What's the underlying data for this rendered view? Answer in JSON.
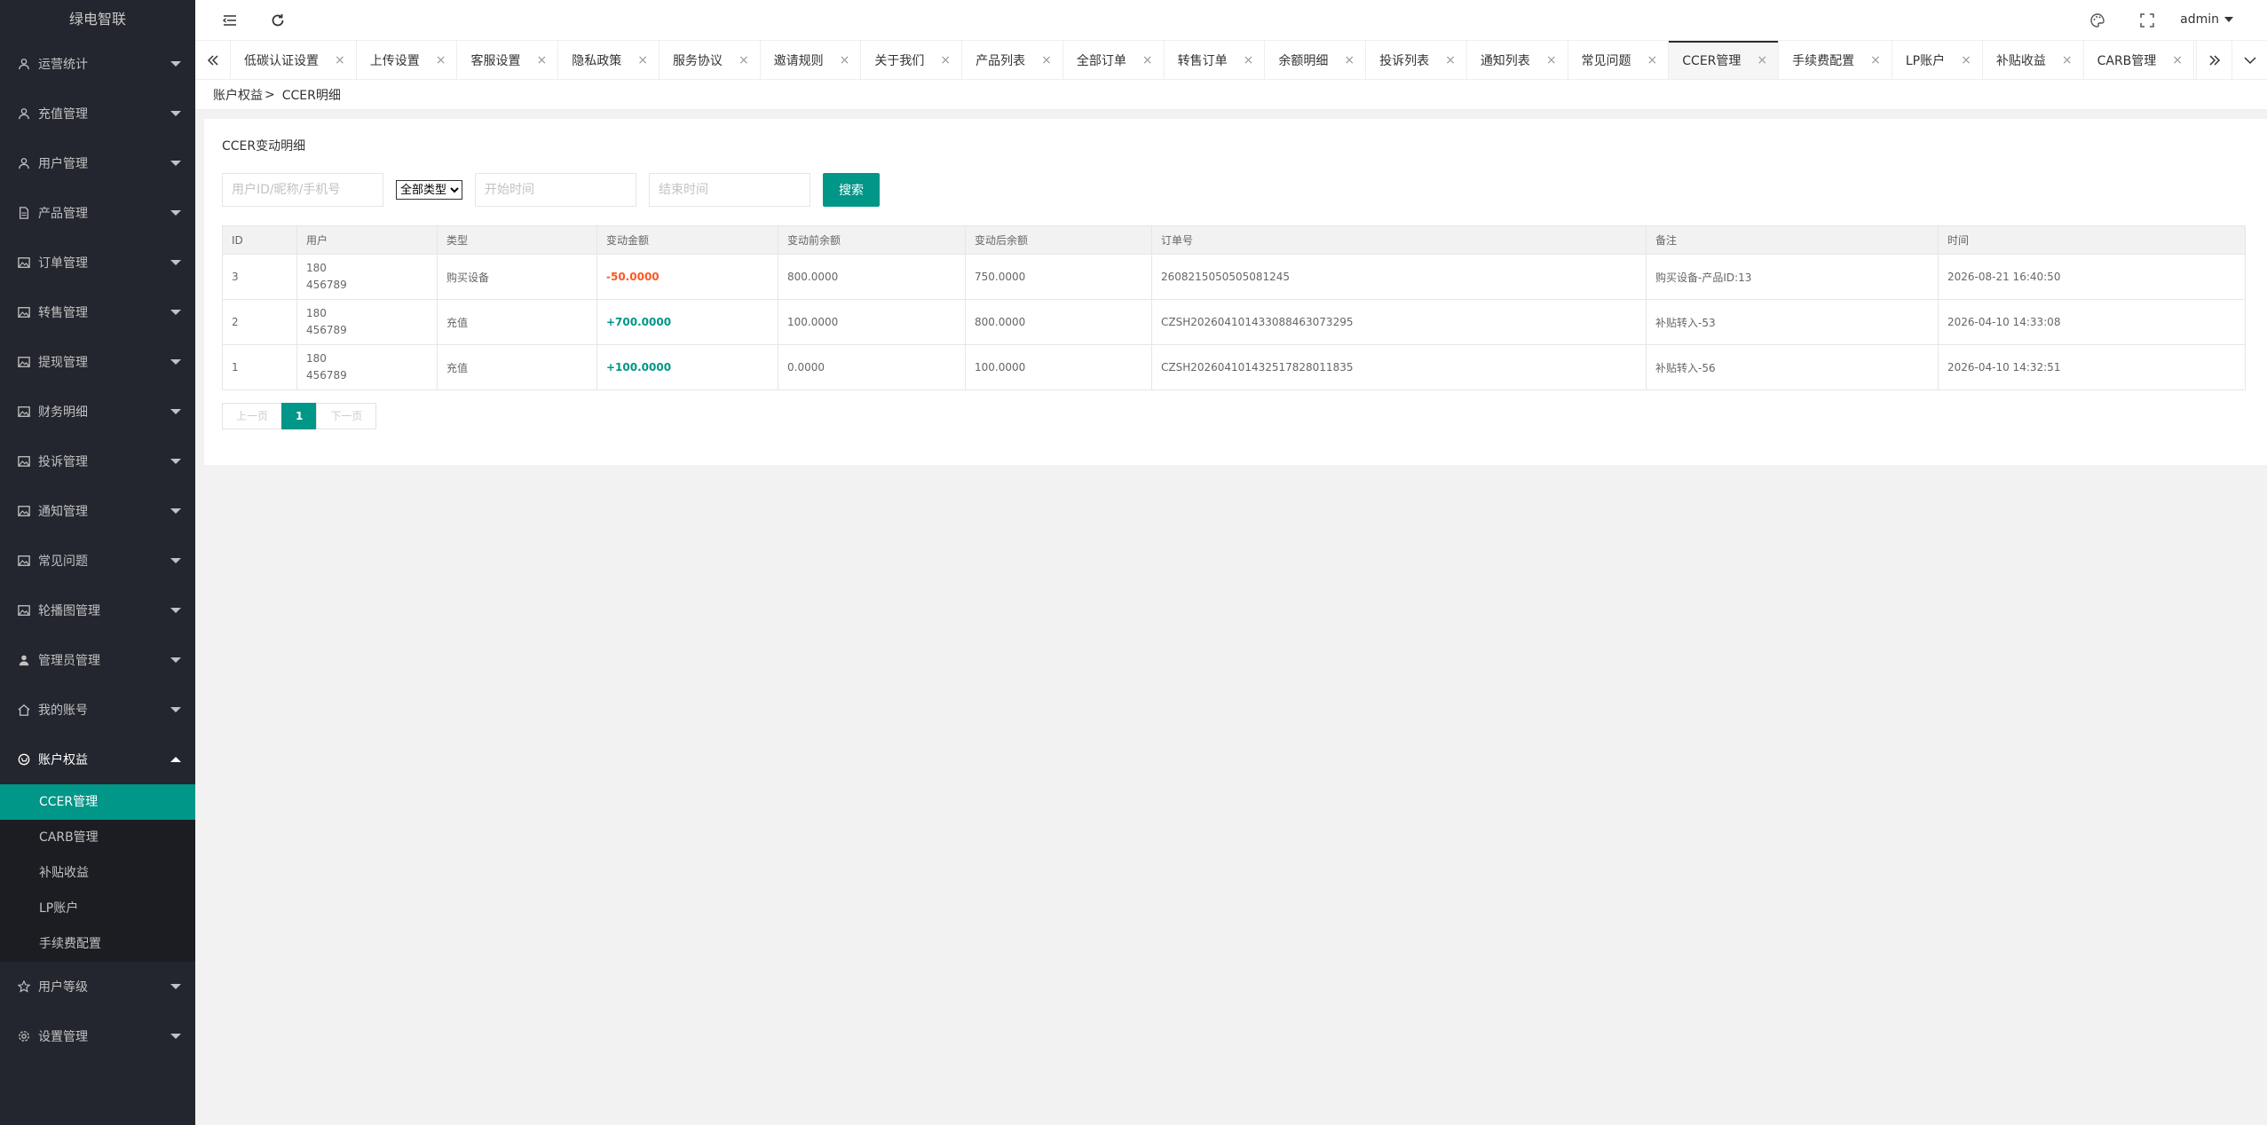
{
  "app": {
    "title": "绿电智联"
  },
  "sidebar": {
    "items": [
      {
        "label": "运营统计",
        "icon": "user-icon"
      },
      {
        "label": "充值管理",
        "icon": "user-icon"
      },
      {
        "label": "用户管理",
        "icon": "user-icon"
      },
      {
        "label": "产品管理",
        "icon": "file-icon"
      },
      {
        "label": "订单管理",
        "icon": "image-icon"
      },
      {
        "label": "转售管理",
        "icon": "image-icon"
      },
      {
        "label": "提现管理",
        "icon": "image-icon"
      },
      {
        "label": "财务明细",
        "icon": "image-icon"
      },
      {
        "label": "投诉管理",
        "icon": "image-icon"
      },
      {
        "label": "通知管理",
        "icon": "image-icon"
      },
      {
        "label": "常见问题",
        "icon": "image-icon"
      },
      {
        "label": "轮播图管理",
        "icon": "image-icon"
      },
      {
        "label": "管理员管理",
        "icon": "person-icon"
      },
      {
        "label": "我的账号",
        "icon": "home-icon"
      },
      {
        "label": "账户权益",
        "icon": "cart-icon"
      }
    ],
    "sub_items": [
      {
        "label": "CCER管理"
      },
      {
        "label": "CARB管理"
      },
      {
        "label": "补贴收益"
      },
      {
        "label": "LP账户"
      },
      {
        "label": "手续费配置"
      }
    ],
    "bottom_items": [
      {
        "label": "用户等级",
        "icon": "star-icon"
      },
      {
        "label": "设置管理",
        "icon": "gear-icon"
      }
    ]
  },
  "header": {
    "user": "admin"
  },
  "tabs": [
    {
      "label": "低碳认证设置"
    },
    {
      "label": "上传设置"
    },
    {
      "label": "客服设置"
    },
    {
      "label": "隐私政策"
    },
    {
      "label": "服务协议"
    },
    {
      "label": "邀请规则"
    },
    {
      "label": "关于我们"
    },
    {
      "label": "产品列表"
    },
    {
      "label": "全部订单"
    },
    {
      "label": "转售订单"
    },
    {
      "label": "余额明细"
    },
    {
      "label": "投诉列表"
    },
    {
      "label": "通知列表"
    },
    {
      "label": "常见问题"
    },
    {
      "label": "CCER管理"
    },
    {
      "label": "手续费配置"
    },
    {
      "label": "LP账户"
    },
    {
      "label": "补贴收益"
    },
    {
      "label": "CARB管理"
    }
  ],
  "breadcrumb": {
    "parent": "账户权益",
    "sep": ">",
    "current": "CCER明细"
  },
  "card": {
    "title": "CCER变动明细"
  },
  "search": {
    "keyword_placeholder": "用户ID/昵称/手机号",
    "type_selected": "全部类型",
    "start_placeholder": "开始时间",
    "end_placeholder": "结束时间",
    "button": "搜索"
  },
  "table": {
    "headers": [
      "ID",
      "用户",
      "类型",
      "变动金额",
      "变动前余额",
      "变动后余额",
      "订单号",
      "备注",
      "时间"
    ],
    "rows": [
      {
        "id": "3",
        "user1": "180",
        "user2": "456789",
        "type": "购买设备",
        "amount": "-50.0000",
        "before": "800.0000",
        "after": "750.0000",
        "order": "2608215050505081245",
        "note": "购买设备-产品ID:13",
        "time": "2026-08-21 16:40:50"
      },
      {
        "id": "2",
        "user1": "180",
        "user2": "456789",
        "type": "充值",
        "amount": "+700.0000",
        "before": "100.0000",
        "after": "800.0000",
        "order": "CZSH20260410143308846307329​5",
        "note": "补贴转入-53",
        "time": "2026-04-10 14:33:08"
      },
      {
        "id": "1",
        "user1": "180",
        "user2": "456789",
        "type": "充值",
        "amount": "+100.0000",
        "before": "0.0000",
        "after": "100.0000",
        "order": "CZSH202604101432517828011835",
        "note": "补贴转入-56",
        "time": "2026-04-10 14:32:51"
      }
    ]
  },
  "pager": {
    "prev": "上一页",
    "current": "1",
    "next": "下一页"
  },
  "colors": {
    "accent": "#009688",
    "negative": "#ff5722",
    "sidebar_bg": "#23262e"
  }
}
